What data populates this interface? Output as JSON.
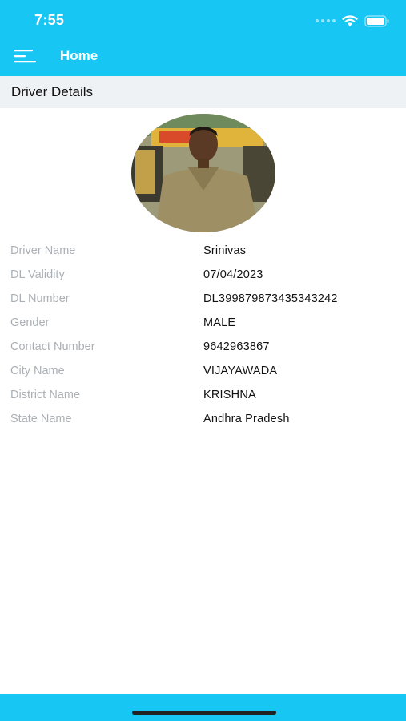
{
  "status_bar": {
    "time": "7:55"
  },
  "header": {
    "title": "Home",
    "menu_icon": "hamburger-menu-icon"
  },
  "section": {
    "title": "Driver Details"
  },
  "colors": {
    "primary": "#18c6f4",
    "section_bg": "#eff2f5",
    "label": "#aab0b5",
    "value": "#111111"
  },
  "details": [
    {
      "label": "Driver Name",
      "value": "Srinivas"
    },
    {
      "label": "DL Validity",
      "value": "07/04/2023"
    },
    {
      "label": "DL Number",
      "value": "DL399879873435343242"
    },
    {
      "label": "Gender",
      "value": "MALE"
    },
    {
      "label": "Contact Number",
      "value": "9642963867"
    },
    {
      "label": "City Name",
      "value": "VIJAYAWADA"
    },
    {
      "label": "District Name",
      "value": "KRISHNA"
    },
    {
      "label": "State Name",
      "value": "Andhra Pradesh"
    }
  ]
}
